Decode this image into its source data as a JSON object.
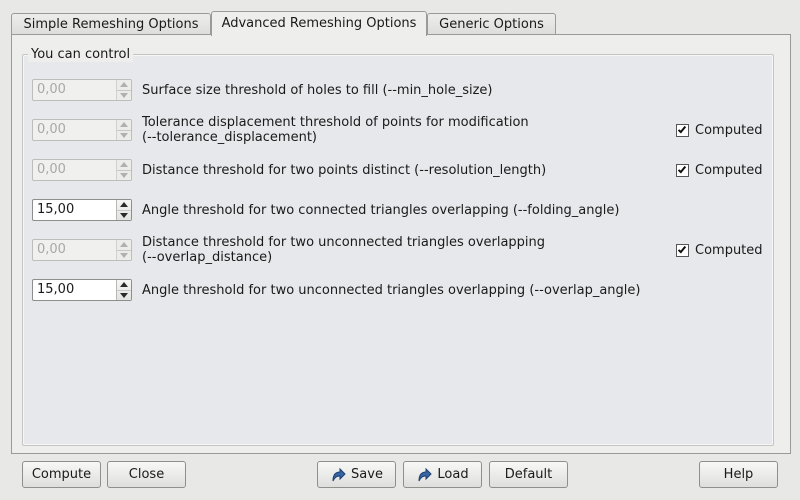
{
  "tabs": [
    {
      "label": "Simple Remeshing Options",
      "active": false
    },
    {
      "label": "Advanced Remeshing Options",
      "active": true
    },
    {
      "label": "Generic Options",
      "active": false
    }
  ],
  "group": {
    "title": "You can control"
  },
  "rows": [
    {
      "value": "0,00",
      "enabled": false,
      "label": "Surface size threshold of holes to fill (--min_hole_size)",
      "computed": null
    },
    {
      "value": "0,00",
      "enabled": false,
      "label_line1": "Tolerance displacement threshold of points for modification",
      "label_line2": "(--tolerance_displacement)",
      "computed": {
        "label": "Computed",
        "checked": true
      }
    },
    {
      "value": "0,00",
      "enabled": false,
      "label": "Distance threshold for two points distinct (--resolution_length)",
      "computed": {
        "label": "Computed",
        "checked": true
      }
    },
    {
      "value": "15,00",
      "enabled": true,
      "label": "Angle threshold for two connected triangles overlapping (--folding_angle)",
      "computed": null
    },
    {
      "value": "0,00",
      "enabled": false,
      "label_line1": "Distance threshold for two unconnected triangles overlapping",
      "label_line2": "(--overlap_distance)",
      "computed": {
        "label": "Computed",
        "checked": true
      }
    },
    {
      "value": "15,00",
      "enabled": true,
      "label": "Angle threshold for two unconnected triangles overlapping (--overlap_angle)",
      "computed": null
    }
  ],
  "buttons": {
    "compute": "Compute",
    "close": "Close",
    "save": "Save",
    "load": "Load",
    "default": "Default",
    "help": "Help"
  },
  "icons": {
    "save": "save-arrow-icon",
    "load": "load-arrow-icon"
  },
  "colors": {
    "icon_blue": "#3465a4"
  }
}
